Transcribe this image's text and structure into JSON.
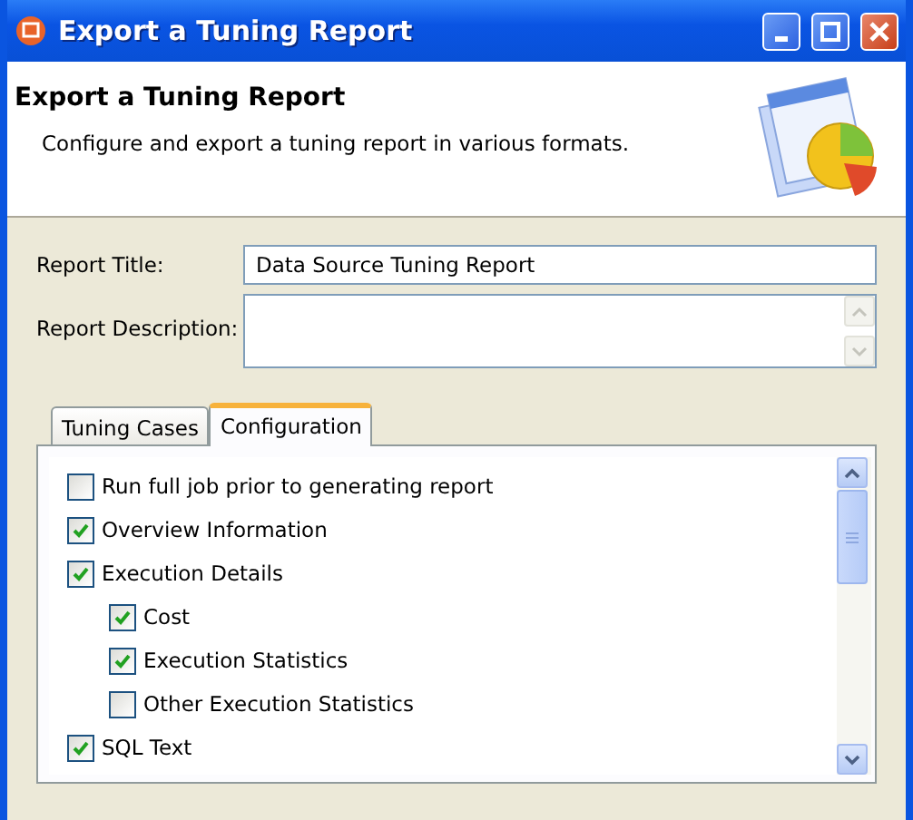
{
  "window": {
    "title": "Export a Tuning Report"
  },
  "header": {
    "title": "Export a Tuning Report",
    "description": "Configure and export a tuning report in various formats."
  },
  "fields": [
    {
      "kind": "text",
      "label": "Report Title:",
      "value": "Data Source Tuning Report"
    },
    {
      "kind": "textarea",
      "label": "Report Description:"
    }
  ],
  "tabs": [
    {
      "label": "Tuning Cases",
      "selected": false
    },
    {
      "label": "Configuration",
      "selected": true
    }
  ],
  "options": [
    {
      "label": "Run full job prior to generating report",
      "checked": false
    },
    {
      "label": "Overview Information",
      "checked": true
    },
    {
      "label": "Execution Details",
      "checked": true,
      "children": [
        {
          "label": "Cost",
          "checked": true
        },
        {
          "label": "Execution Statistics",
          "checked": true
        },
        {
          "label": "Other Execution Statistics",
          "checked": false
        }
      ]
    },
    {
      "label": "SQL Text",
      "checked": true
    }
  ]
}
